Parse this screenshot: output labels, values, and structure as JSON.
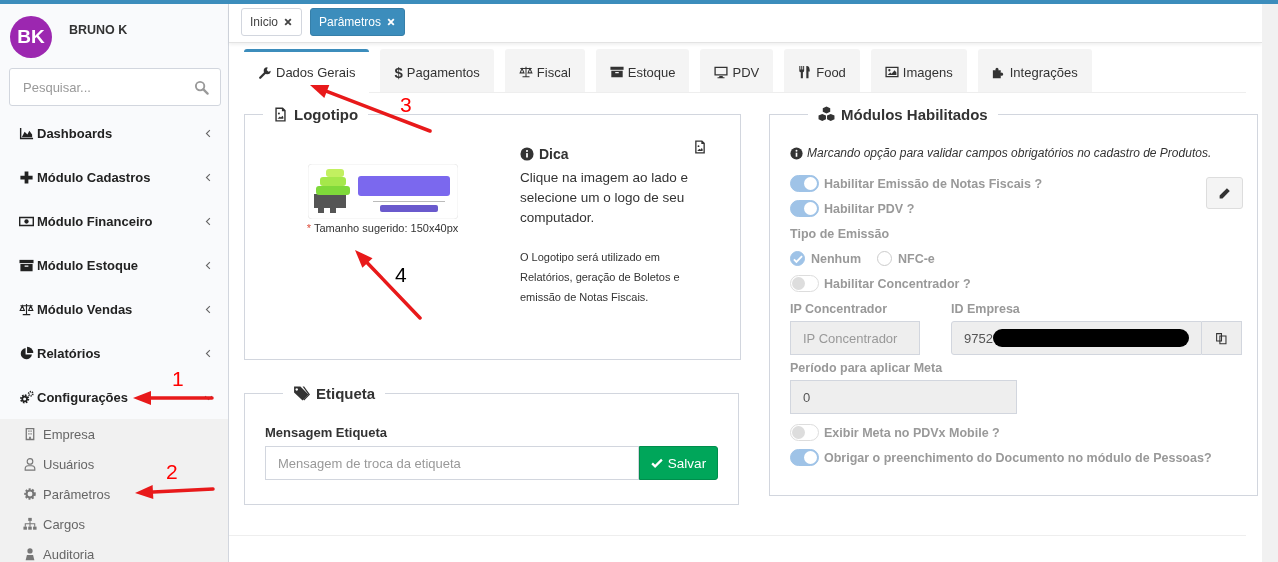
{
  "user": {
    "initials": "BK",
    "name": "BRUNO K"
  },
  "search": {
    "placeholder": "Pesquisar..."
  },
  "menu": [
    {
      "label": "Dashboards",
      "expanded": false
    },
    {
      "label": "Módulo Cadastros",
      "expanded": false
    },
    {
      "label": "Módulo Financeiro",
      "expanded": false
    },
    {
      "label": "Módulo Estoque",
      "expanded": false
    },
    {
      "label": "Módulo Vendas",
      "expanded": false
    },
    {
      "label": "Relatórios",
      "expanded": false
    },
    {
      "label": "Configurações",
      "expanded": true,
      "children": [
        {
          "label": "Empresa"
        },
        {
          "label": "Usuários"
        },
        {
          "label": "Parâmetros"
        },
        {
          "label": "Cargos"
        },
        {
          "label": "Auditoria"
        }
      ]
    }
  ],
  "open_tabs": [
    {
      "label": "Inicio",
      "selected": false
    },
    {
      "label": "Parâmetros",
      "selected": true
    }
  ],
  "tabs": [
    {
      "label": "Dados Gerais",
      "selected": true
    },
    {
      "label": "Pagamentos",
      "symbol": "$",
      "selected": false
    },
    {
      "label": "Fiscal",
      "selected": false
    },
    {
      "label": "Estoque",
      "selected": false
    },
    {
      "label": "PDV",
      "selected": false
    },
    {
      "label": "Food",
      "selected": false
    },
    {
      "label": "Imagens",
      "selected": false
    },
    {
      "label": "Integrações",
      "selected": false
    }
  ],
  "logo_panel": {
    "title": "Logotipo",
    "required_mark": "*",
    "size_hint": "Tamanho sugerido: 150x40px",
    "tip_title": "Dica",
    "tip_text": "Clique na imagem ao lado e selecione um o logo de seu computador.",
    "usage_text": "O Logotipo será utilizado em Relatórios, geração de Boletos e emissão de Notas Fiscais."
  },
  "label_panel": {
    "title": "Etiqueta",
    "field_label": "Mensagem Etiqueta",
    "placeholder": "Mensagem de troca da etiqueta",
    "button": "Salvar"
  },
  "modules_panel": {
    "title": "Módulos Habilitados",
    "disabled": true,
    "note": "Marcando opção para validar campos obrigatórios no cadastro de Produtos.",
    "rows": [
      {
        "kind": "switch",
        "label": "Habilitar Emissão de Notas Fiscais ?",
        "on": true
      },
      {
        "kind": "switch",
        "label": "Habilitar PDV ?",
        "on": true
      },
      {
        "kind": "heading",
        "label": "Tipo de Emissão"
      },
      {
        "kind": "radios",
        "options": [
          {
            "label": "Nenhum",
            "selected": true
          },
          {
            "label": "NFC-e",
            "selected": false
          }
        ]
      },
      {
        "kind": "switch",
        "label": "Habilitar Concentrador ?",
        "on": false
      },
      {
        "kind": "field_pair",
        "fields": [
          {
            "kind": "text",
            "label": "IP Concentrador",
            "placeholder": "IP Concentrador"
          },
          {
            "kind": "copy",
            "label": "ID Empresa",
            "value": "9752",
            "redacted": true
          }
        ]
      },
      {
        "kind": "field",
        "label": "Período para aplicar Meta",
        "value": "0"
      },
      {
        "kind": "switch",
        "label": "Exibir Meta no PDVx Mobile ?",
        "on": false
      },
      {
        "kind": "switch",
        "label": "Obrigar o preenchimento do Documento no módulo de Pessoas?",
        "on": true
      }
    ]
  },
  "annotations": [
    {
      "number": "1",
      "color": "#ff0000"
    },
    {
      "number": "2",
      "color": "#ff0000"
    },
    {
      "number": "3",
      "color": "#ff0000"
    },
    {
      "number": "4",
      "color": "#000000"
    }
  ]
}
